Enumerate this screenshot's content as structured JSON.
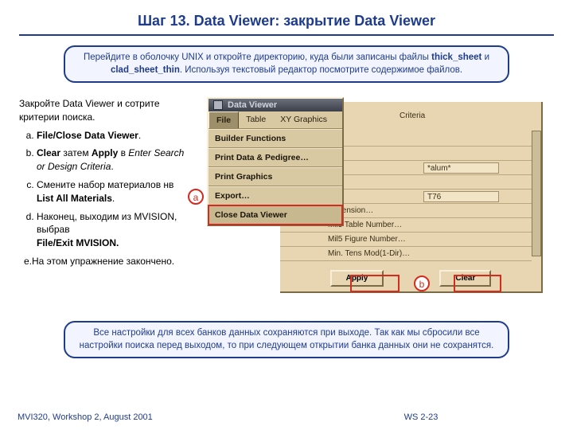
{
  "title": "Шаг 13.  Data Viewer:  закрытие Data Viewer",
  "callout_top": {
    "line1a": "Перейдите в оболочку UNIX и откройте директорию, куда были записаны файлы ",
    "b1": "thick_sheet",
    "line1b": " и ",
    "b2": "clad_sheet_thin",
    "line1c": ". Используя текстовый редактор посмотрите содержимое файлов."
  },
  "instructions": {
    "intro": "Закройте Data Viewer и сотрите критерии поиска.",
    "a": {
      "t1": "File/Close Data Viewer",
      "t2": "."
    },
    "b": {
      "t1": "Clear",
      "t2": " затем ",
      "t3": "Apply",
      "t4": " в ",
      "i1": "Enter Search or Design Criteria",
      "t5": "."
    },
    "c": {
      "t1": "Смените набор материалов нв ",
      "b1": "List All Materials",
      "t2": "."
    },
    "d": {
      "t1": "Наконец, выходим из MVISION, выбрав",
      "line2": "File/Exit MVISION."
    },
    "e": "e.На этом упражнение закончено."
  },
  "dv": {
    "title": "Data Viewer",
    "menu": [
      "File",
      "Table",
      "XY Graphics"
    ],
    "items": [
      "Builder Functions",
      "Print Data & Pedigree…",
      "Print Graphics",
      "Export…",
      "Close Data Viewer"
    ]
  },
  "bg": {
    "criteria": "Criteria",
    "rows": [
      "Dimension…",
      "Mil5 Table Number…",
      "Mil5 Figure Number…",
      "Min. Tens Mod(1-Dir)…"
    ],
    "cell1": "*alum*",
    "cell2": "T76",
    "apply": "Apply",
    "clear": "Clear"
  },
  "labels": {
    "a": "a",
    "b": "b"
  },
  "callout_bottom": "Все настройки для всех банков данных сохраняются при выходе. Так как мы сбросили все настройки поиска перед выходом,  то при следующем открытии банка данных они не сохранятся.",
  "footer": {
    "left": "MVI320, Workshop 2, August 2001",
    "mid": "WS 2-23"
  }
}
